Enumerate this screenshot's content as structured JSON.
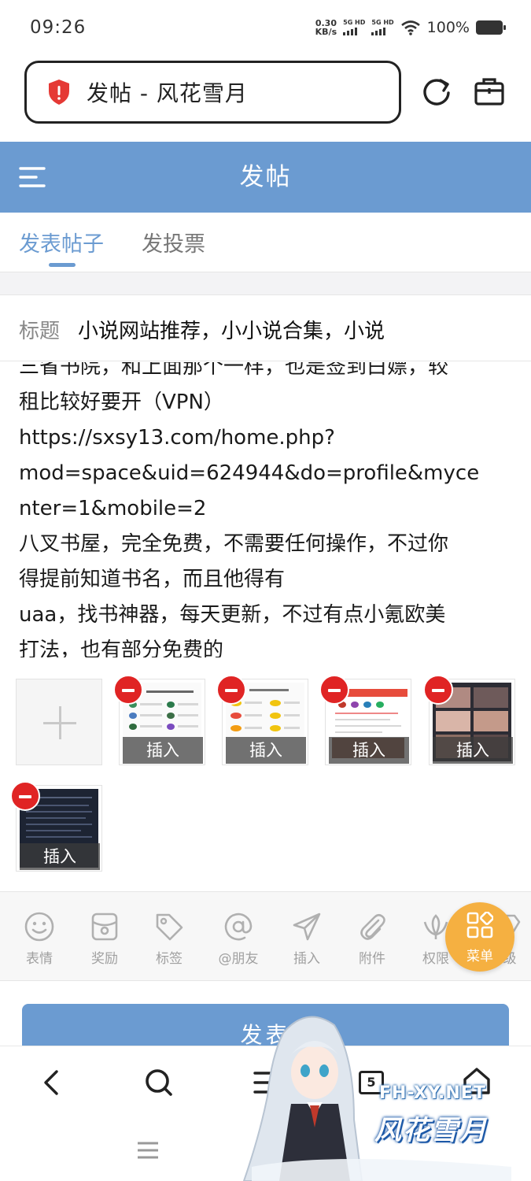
{
  "status_bar": {
    "time": "09:26",
    "net_speed_value": "0.30",
    "net_speed_unit": "KB/s",
    "sim1_label": "5G HD",
    "sim2_label": "5G HD",
    "battery_percent": "100%"
  },
  "browser": {
    "url_title": "发帖 - 风花雪月",
    "security_icon": "shield-alert-icon",
    "refresh_icon": "refresh-icon",
    "toolbox_icon": "briefcase-icon"
  },
  "header": {
    "title": "发帖",
    "menu_icon": "menu-icon",
    "color": "#6b9bd1"
  },
  "tabs": [
    {
      "label": "发表帖子",
      "active": true
    },
    {
      "label": "发投票",
      "active": false
    }
  ],
  "form": {
    "title_label": "标题",
    "title_value": "小说网站推荐，小小说合集，小说",
    "body_lines": [
      "三省书院，和上面那个一样，也是签到白嫖，较",
      "租比较好要开（VPN）",
      "https://sxsy13.com/home.php?",
      "mod=space&uid=624944&do=profile&myce",
      "nter=1&mobile=2",
      "八叉书屋，完全免费，不需要任何操作，不过你",
      "得提前知道书名，而且他得有",
      "uaa，找书神器，每天更新，不过有点小氪欧美",
      "打法，也有部分免费的"
    ]
  },
  "attachments": {
    "add_icon": "plus-icon",
    "insert_label": "插入",
    "count": 6
  },
  "toolbar": {
    "items": [
      {
        "label": "表情",
        "icon": "smiley-icon"
      },
      {
        "label": "奖励",
        "icon": "reward-icon"
      },
      {
        "label": "标签",
        "icon": "tag-icon"
      },
      {
        "label": "@朋友",
        "icon": "at-icon"
      },
      {
        "label": "插入",
        "icon": "send-icon"
      },
      {
        "label": "附件",
        "icon": "paperclip-icon"
      },
      {
        "label": "权限",
        "icon": "lotus-icon"
      },
      {
        "label": "级",
        "icon": "diamond-icon"
      }
    ],
    "fab_label": "菜单",
    "fab_color": "#f5b041"
  },
  "submit": {
    "label": "发表"
  },
  "bottom_nav": {
    "tab_count": "5",
    "icons": [
      "back-icon",
      "search-icon",
      "menu-icon",
      "tabs-icon",
      "home-icon",
      "gesture-menu-icon"
    ]
  },
  "watermark": {
    "site": "FH-XY.NET",
    "name": "风花雪月"
  }
}
